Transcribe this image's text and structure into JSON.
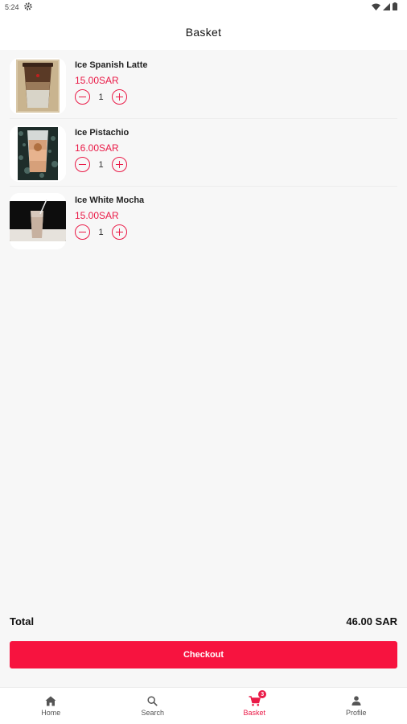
{
  "status_bar": {
    "time": "5:24"
  },
  "header": {
    "title": "Basket"
  },
  "items": [
    {
      "name": "Ice Spanish Latte",
      "price": "15.00SAR",
      "quantity": "1"
    },
    {
      "name": "Ice Pistachio",
      "price": "16.00SAR",
      "quantity": "1"
    },
    {
      "name": "Ice White Mocha",
      "price": "15.00SAR",
      "quantity": "1"
    }
  ],
  "summary": {
    "total_label": "Total",
    "total_value": "46.00 SAR"
  },
  "checkout": {
    "label": "Checkout"
  },
  "nav": {
    "home": "Home",
    "search": "Search",
    "basket": "Basket",
    "basket_badge": "3",
    "profile": "Profile"
  },
  "colors": {
    "accent": "#ea1a47",
    "checkout": "#f7133f"
  }
}
